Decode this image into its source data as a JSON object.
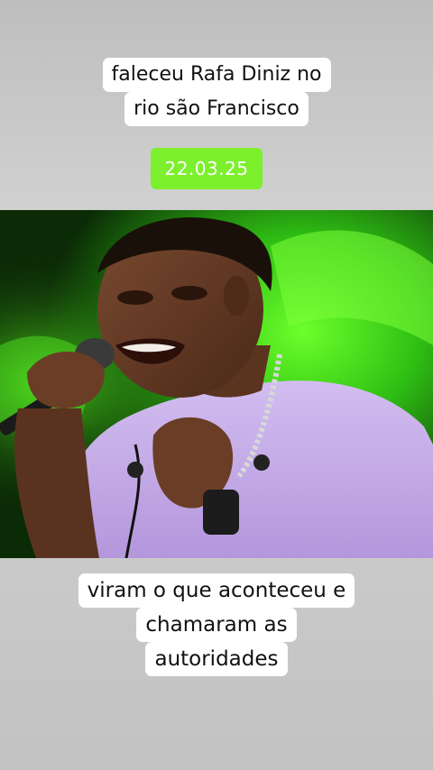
{
  "top_caption": {
    "line1": "faleceu Rafa Diniz no",
    "line2": "rio são Francisco"
  },
  "date_badge": "22.03.25",
  "photo": {
    "description_icon": "singer-photo-icon"
  },
  "bottom_caption": {
    "line1": "viram o que aconteceu e",
    "line2": "chamaram as",
    "line3": "autoridades"
  },
  "colors": {
    "background": "#c8c8c8",
    "badge": "#7cf02c",
    "caption_bg": "#ffffff",
    "stage_green": "#3fd81a",
    "shirt": "#c7b0e6"
  }
}
